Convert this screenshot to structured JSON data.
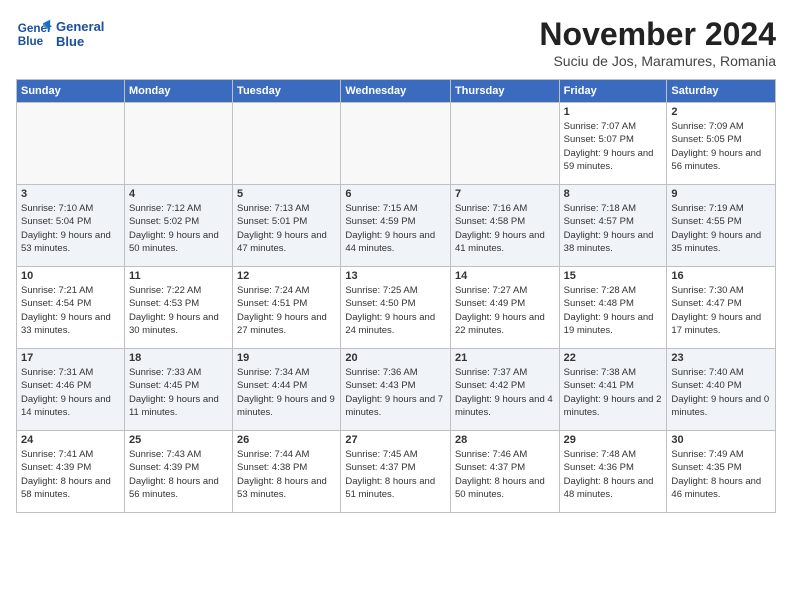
{
  "logo": {
    "line1": "General",
    "line2": "Blue"
  },
  "title": "November 2024",
  "subtitle": "Suciu de Jos, Maramures, Romania",
  "days_of_week": [
    "Sunday",
    "Monday",
    "Tuesday",
    "Wednesday",
    "Thursday",
    "Friday",
    "Saturday"
  ],
  "weeks": [
    [
      {
        "day": "",
        "info": ""
      },
      {
        "day": "",
        "info": ""
      },
      {
        "day": "",
        "info": ""
      },
      {
        "day": "",
        "info": ""
      },
      {
        "day": "",
        "info": ""
      },
      {
        "day": "1",
        "info": "Sunrise: 7:07 AM\nSunset: 5:07 PM\nDaylight: 9 hours and 59 minutes."
      },
      {
        "day": "2",
        "info": "Sunrise: 7:09 AM\nSunset: 5:05 PM\nDaylight: 9 hours and 56 minutes."
      }
    ],
    [
      {
        "day": "3",
        "info": "Sunrise: 7:10 AM\nSunset: 5:04 PM\nDaylight: 9 hours and 53 minutes."
      },
      {
        "day": "4",
        "info": "Sunrise: 7:12 AM\nSunset: 5:02 PM\nDaylight: 9 hours and 50 minutes."
      },
      {
        "day": "5",
        "info": "Sunrise: 7:13 AM\nSunset: 5:01 PM\nDaylight: 9 hours and 47 minutes."
      },
      {
        "day": "6",
        "info": "Sunrise: 7:15 AM\nSunset: 4:59 PM\nDaylight: 9 hours and 44 minutes."
      },
      {
        "day": "7",
        "info": "Sunrise: 7:16 AM\nSunset: 4:58 PM\nDaylight: 9 hours and 41 minutes."
      },
      {
        "day": "8",
        "info": "Sunrise: 7:18 AM\nSunset: 4:57 PM\nDaylight: 9 hours and 38 minutes."
      },
      {
        "day": "9",
        "info": "Sunrise: 7:19 AM\nSunset: 4:55 PM\nDaylight: 9 hours and 35 minutes."
      }
    ],
    [
      {
        "day": "10",
        "info": "Sunrise: 7:21 AM\nSunset: 4:54 PM\nDaylight: 9 hours and 33 minutes."
      },
      {
        "day": "11",
        "info": "Sunrise: 7:22 AM\nSunset: 4:53 PM\nDaylight: 9 hours and 30 minutes."
      },
      {
        "day": "12",
        "info": "Sunrise: 7:24 AM\nSunset: 4:51 PM\nDaylight: 9 hours and 27 minutes."
      },
      {
        "day": "13",
        "info": "Sunrise: 7:25 AM\nSunset: 4:50 PM\nDaylight: 9 hours and 24 minutes."
      },
      {
        "day": "14",
        "info": "Sunrise: 7:27 AM\nSunset: 4:49 PM\nDaylight: 9 hours and 22 minutes."
      },
      {
        "day": "15",
        "info": "Sunrise: 7:28 AM\nSunset: 4:48 PM\nDaylight: 9 hours and 19 minutes."
      },
      {
        "day": "16",
        "info": "Sunrise: 7:30 AM\nSunset: 4:47 PM\nDaylight: 9 hours and 17 minutes."
      }
    ],
    [
      {
        "day": "17",
        "info": "Sunrise: 7:31 AM\nSunset: 4:46 PM\nDaylight: 9 hours and 14 minutes."
      },
      {
        "day": "18",
        "info": "Sunrise: 7:33 AM\nSunset: 4:45 PM\nDaylight: 9 hours and 11 minutes."
      },
      {
        "day": "19",
        "info": "Sunrise: 7:34 AM\nSunset: 4:44 PM\nDaylight: 9 hours and 9 minutes."
      },
      {
        "day": "20",
        "info": "Sunrise: 7:36 AM\nSunset: 4:43 PM\nDaylight: 9 hours and 7 minutes."
      },
      {
        "day": "21",
        "info": "Sunrise: 7:37 AM\nSunset: 4:42 PM\nDaylight: 9 hours and 4 minutes."
      },
      {
        "day": "22",
        "info": "Sunrise: 7:38 AM\nSunset: 4:41 PM\nDaylight: 9 hours and 2 minutes."
      },
      {
        "day": "23",
        "info": "Sunrise: 7:40 AM\nSunset: 4:40 PM\nDaylight: 9 hours and 0 minutes."
      }
    ],
    [
      {
        "day": "24",
        "info": "Sunrise: 7:41 AM\nSunset: 4:39 PM\nDaylight: 8 hours and 58 minutes."
      },
      {
        "day": "25",
        "info": "Sunrise: 7:43 AM\nSunset: 4:39 PM\nDaylight: 8 hours and 56 minutes."
      },
      {
        "day": "26",
        "info": "Sunrise: 7:44 AM\nSunset: 4:38 PM\nDaylight: 8 hours and 53 minutes."
      },
      {
        "day": "27",
        "info": "Sunrise: 7:45 AM\nSunset: 4:37 PM\nDaylight: 8 hours and 51 minutes."
      },
      {
        "day": "28",
        "info": "Sunrise: 7:46 AM\nSunset: 4:37 PM\nDaylight: 8 hours and 50 minutes."
      },
      {
        "day": "29",
        "info": "Sunrise: 7:48 AM\nSunset: 4:36 PM\nDaylight: 8 hours and 48 minutes."
      },
      {
        "day": "30",
        "info": "Sunrise: 7:49 AM\nSunset: 4:35 PM\nDaylight: 8 hours and 46 minutes."
      }
    ]
  ]
}
